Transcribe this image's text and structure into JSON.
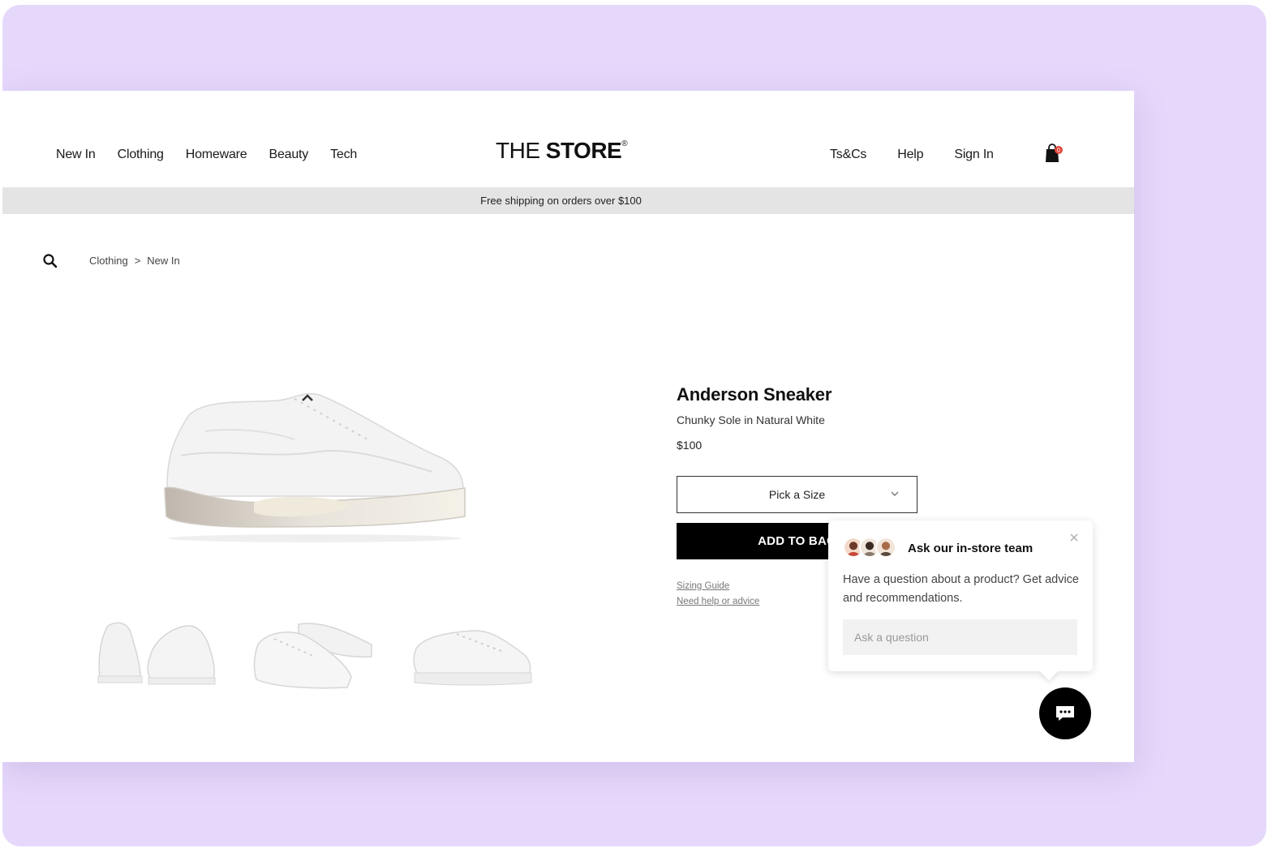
{
  "header": {
    "nav_left": [
      "New In",
      "Clothing",
      "Homeware",
      "Beauty",
      "Tech"
    ],
    "logo_light": "THE ",
    "logo_bold": "STORE",
    "logo_mark": "®",
    "nav_right": [
      "Ts&Cs",
      "Help",
      "Sign In"
    ],
    "cart_icon": "shopping-bag-icon",
    "cart_badge_color": "#e5483b"
  },
  "promo": {
    "text": "Free shipping on orders over $100"
  },
  "breadcrumb": {
    "items": [
      "Clothing",
      "New In"
    ],
    "separator": ">"
  },
  "product": {
    "title": "Anderson Sneaker",
    "subtitle": "Chunky Sole in Natural White",
    "price": "$100",
    "size_select": "Pick a Size",
    "add_button": "ADD TO BAG",
    "sizing_guide": "Sizing Guide",
    "help_link": "Need help or advice"
  },
  "chat": {
    "title": "Ask our in-store team",
    "description": "Have a question about a product? Get advice and recommendations.",
    "input_placeholder": "Ask a question",
    "fab_icon": "chat-bubble-icon"
  },
  "colors": {
    "background_frame": "#e6d8fb",
    "promo_bar": "#e4e4e4",
    "primary_button": "#000000"
  }
}
